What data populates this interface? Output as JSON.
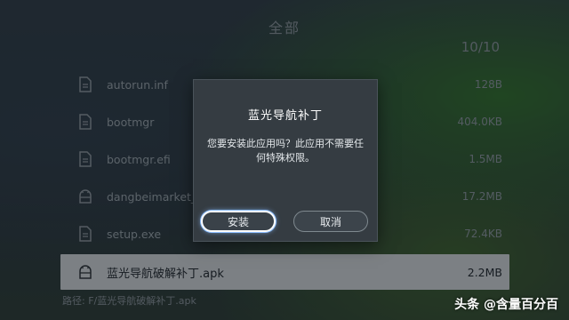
{
  "header": {
    "title": "全部",
    "count": "10/10"
  },
  "files": [
    {
      "name": "autorun.inf",
      "size": "128B",
      "icon": "file-icon"
    },
    {
      "name": "bootmgr",
      "size": "404.0KB",
      "icon": "file-icon"
    },
    {
      "name": "bootmgr.efi",
      "size": "1.5MB",
      "icon": "file-icon"
    },
    {
      "name": "dangbeimarket_4.2.5_...apk",
      "size": "17.2MB",
      "icon": "android-icon"
    },
    {
      "name": "setup.exe",
      "size": "72.4KB",
      "icon": "file-icon"
    },
    {
      "name": "蓝光导航破解补丁.apk",
      "size": "2.2MB",
      "icon": "android-icon"
    }
  ],
  "path": "路径: F/蓝光导航破解补丁.apk",
  "dialog": {
    "title": "蓝光导航补丁",
    "message": "您要安装此应用吗？此应用不需要任何特殊权限。",
    "install_label": "安装",
    "cancel_label": "取消"
  },
  "watermark": "头条 @含量百分百"
}
